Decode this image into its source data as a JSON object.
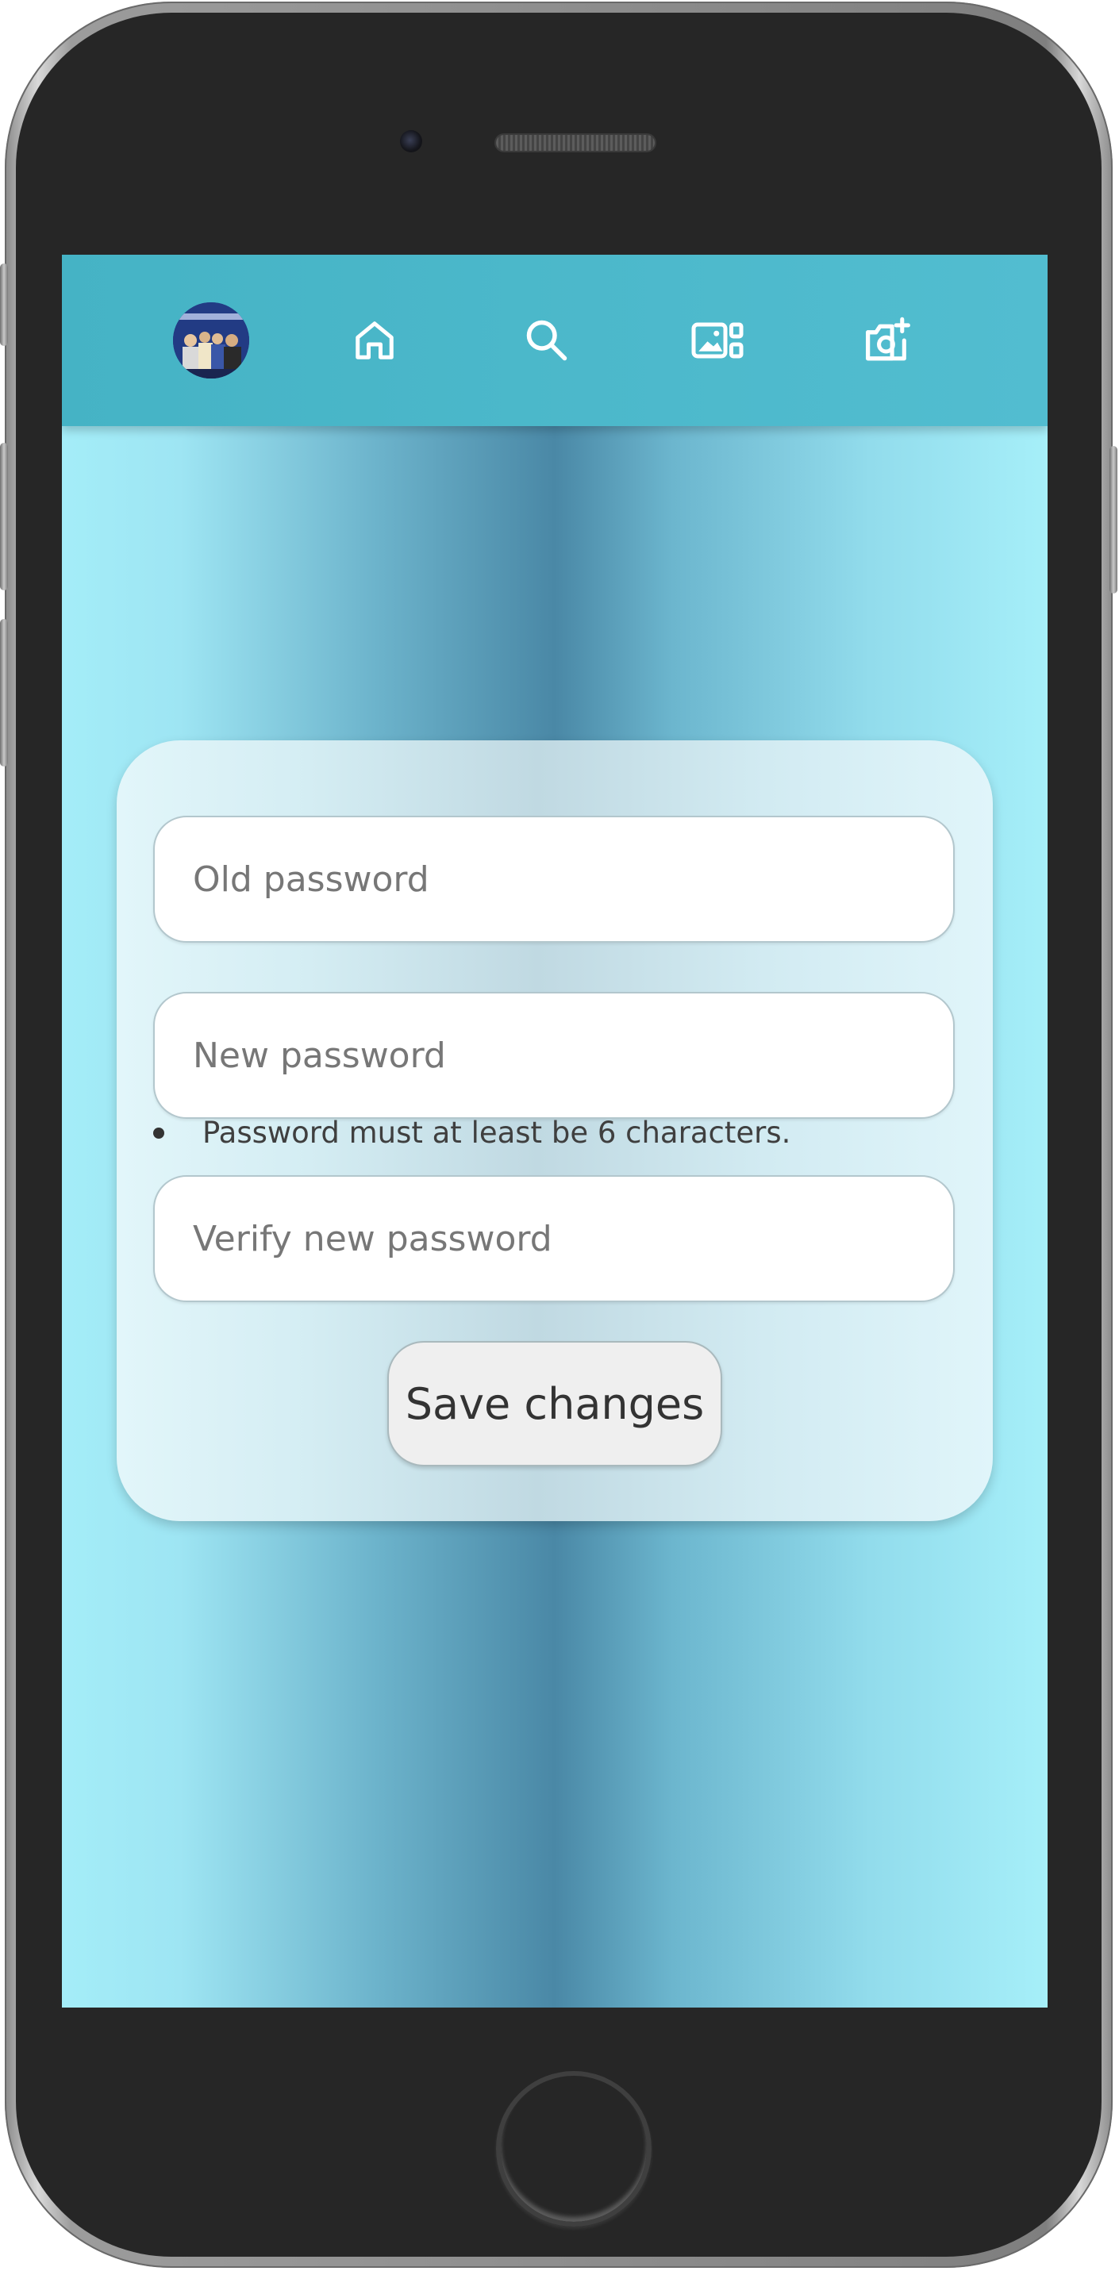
{
  "nav": {
    "icons": [
      "profile-avatar",
      "home-icon",
      "search-icon",
      "gallery-icon",
      "add-photo-icon"
    ]
  },
  "form": {
    "old_password_placeholder": "Old password",
    "new_password_placeholder": "New password",
    "password_hint": "Password must at least be 6 characters.",
    "verify_password_placeholder": "Verify new password",
    "save_label": "Save changes"
  },
  "colors": {
    "navbar": "#4ab8ca",
    "card": "#d4edf3",
    "background_light": "#a4edf8",
    "background_dark": "#4a88a6"
  }
}
